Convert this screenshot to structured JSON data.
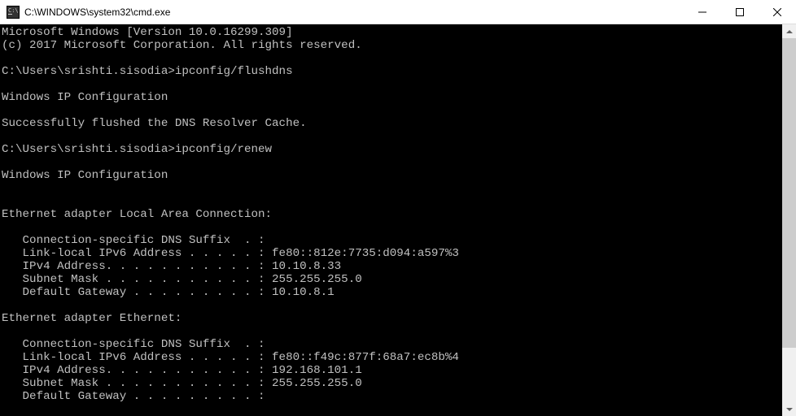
{
  "window": {
    "title": "C:\\WINDOWS\\system32\\cmd.exe"
  },
  "lines": [
    "Microsoft Windows [Version 10.0.16299.309]",
    "(c) 2017 Microsoft Corporation. All rights reserved.",
    "",
    "C:\\Users\\srishti.sisodia>ipconfig/flushdns",
    "",
    "Windows IP Configuration",
    "",
    "Successfully flushed the DNS Resolver Cache.",
    "",
    "C:\\Users\\srishti.sisodia>ipconfig/renew",
    "",
    "Windows IP Configuration",
    "",
    "",
    "Ethernet adapter Local Area Connection:",
    "",
    "   Connection-specific DNS Suffix  . :",
    "   Link-local IPv6 Address . . . . . : fe80::812e:7735:d094:a597%3",
    "   IPv4 Address. . . . . . . . . . . : 10.10.8.33",
    "   Subnet Mask . . . . . . . . . . . : 255.255.255.0",
    "   Default Gateway . . . . . . . . . : 10.10.8.1",
    "",
    "Ethernet adapter Ethernet:",
    "",
    "   Connection-specific DNS Suffix  . :",
    "   Link-local IPv6 Address . . . . . : fe80::f49c:877f:68a7:ec8b%4",
    "   IPv4 Address. . . . . . . . . . . : 192.168.101.1",
    "   Subnet Mask . . . . . . . . . . . : 255.255.255.0",
    "   Default Gateway . . . . . . . . . :"
  ]
}
